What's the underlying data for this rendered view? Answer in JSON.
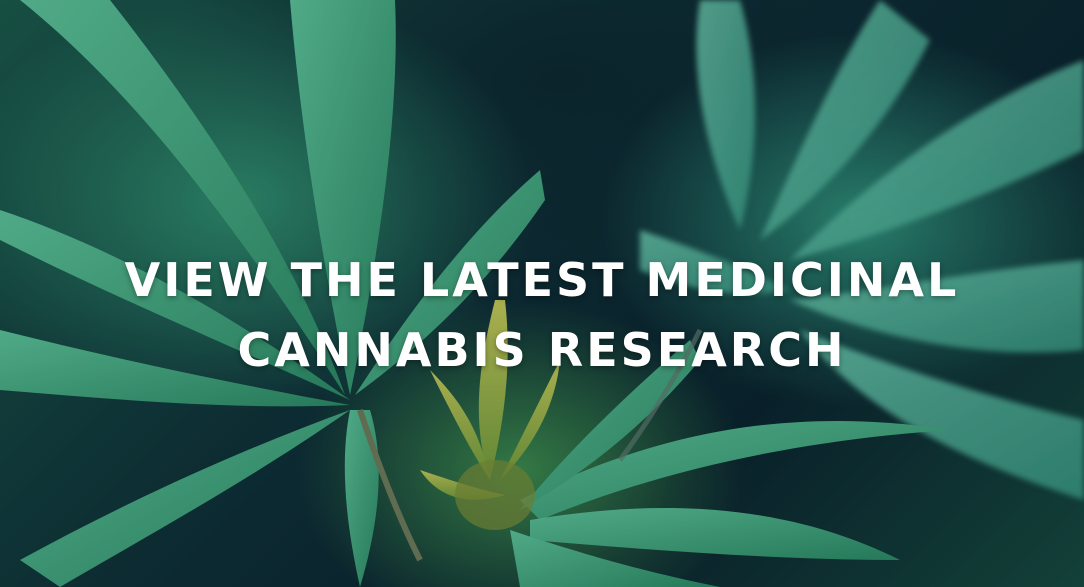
{
  "hero": {
    "headline_line1": "VIEW THE LATEST MEDICINAL",
    "headline_line2": "CANNABIS RESEARCH",
    "background_image": "cannabis-leaf-photo"
  },
  "colors": {
    "text": "#ffffff",
    "leaf_green": "#3fa877",
    "leaf_light": "#7fc49a",
    "dark_background": "#0b2530",
    "bud_yellow": "#a8b84a"
  }
}
